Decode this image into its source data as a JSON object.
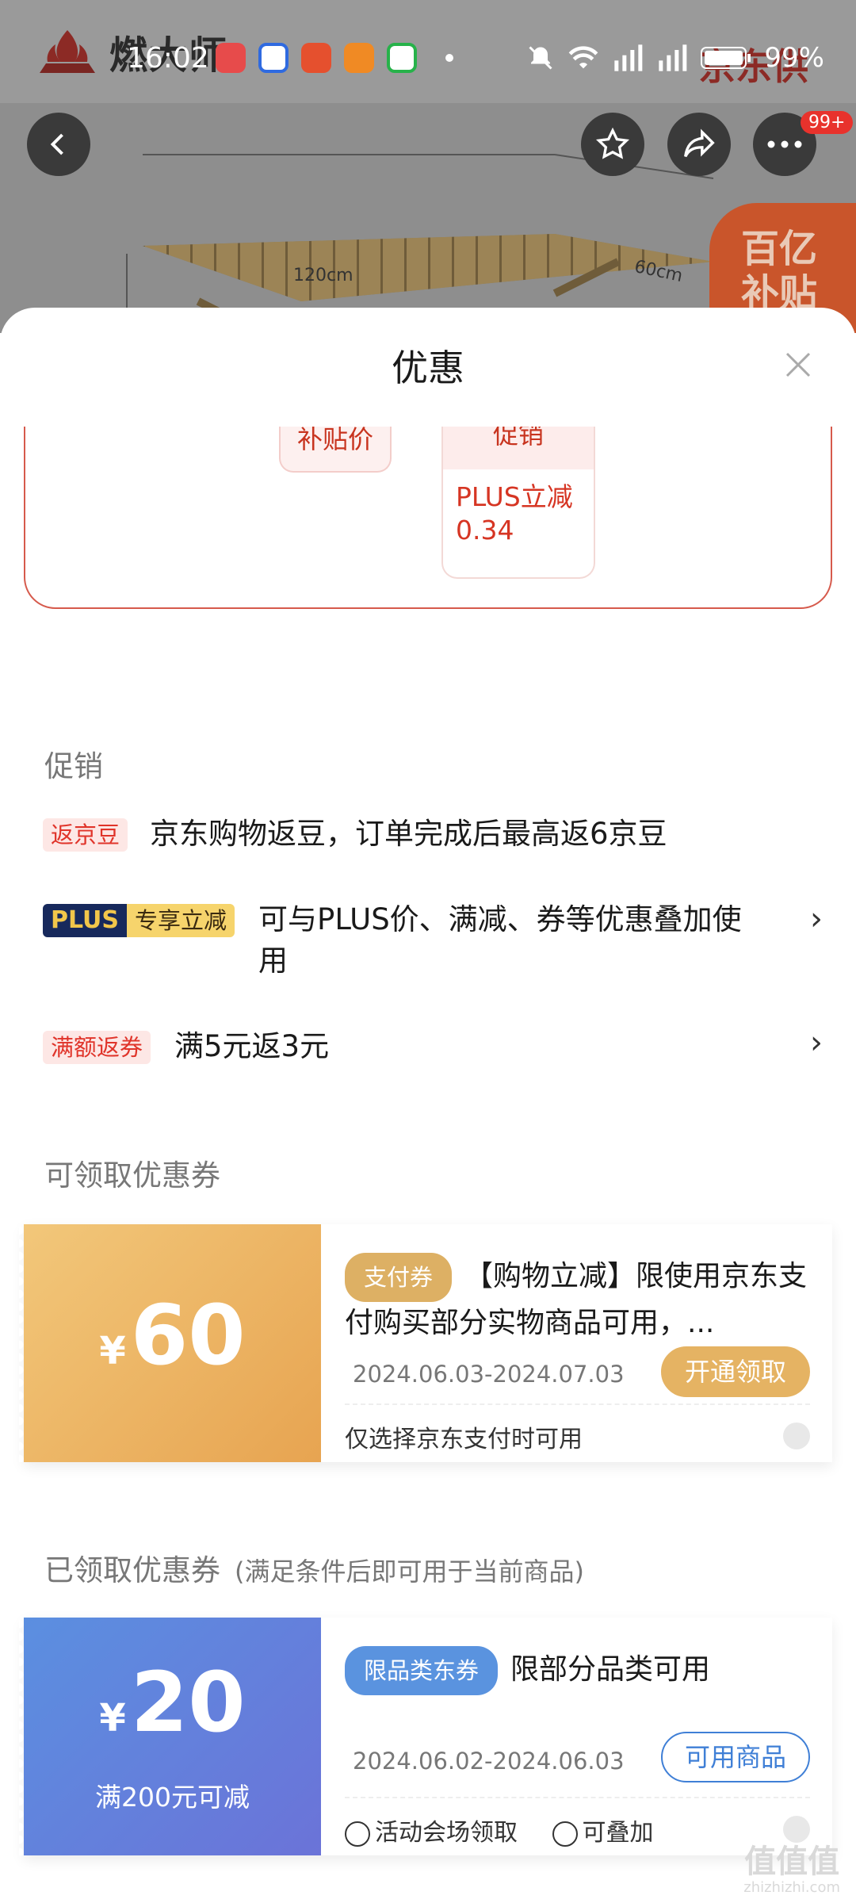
{
  "status_bar": {
    "time": "16:02",
    "battery": "99%",
    "icons": [
      "app-icon-1",
      "baidu-icon",
      "app-icon-3",
      "app-icon-4",
      "app-icon-5",
      "notification-dot",
      "mute-icon",
      "wifi-icon",
      "signal-5g-icon",
      "signal-5g-icon",
      "battery-icon"
    ]
  },
  "background": {
    "shop_brand": "燃大师",
    "shop_right_text": "京东供",
    "dimension_length": "120cm",
    "dimension_width": "60cm",
    "subsidy_badge_line1": "百亿",
    "subsidy_badge_line2": "补贴",
    "cart_badge": "99+"
  },
  "sheet": {
    "title": "优惠",
    "price_card": {
      "subsidy_pill": "补贴价",
      "promo_header": "促销",
      "promo_value": "PLUS立减0.34"
    },
    "promotions": {
      "section_title": "促销",
      "items": [
        {
          "tag": "返京豆",
          "text": "京东购物返豆，订单完成后最高返6京豆"
        },
        {
          "tag_a": "PLUS",
          "tag_b": "专享立减",
          "text": "可与PLUS价、满减、券等优惠叠加使用"
        },
        {
          "tag": "满额返券",
          "text": "满5元返3元"
        }
      ]
    },
    "claimable": {
      "section_title": "可领取优惠券",
      "coupon": {
        "currency": "¥",
        "amount": "60",
        "tag": "支付券",
        "title": "【购物立减】限使用京东支付购买部分实物商品可用，...",
        "date": "2024.06.03-2024.07.03",
        "button": "开通领取",
        "footer": "仅选择京东支付时可用"
      }
    },
    "claimed": {
      "section_title": "已领取优惠券",
      "note": "(满足条件后即可用于当前商品)",
      "coupon": {
        "currency": "¥",
        "amount": "20",
        "condition": "满200元可减",
        "tag": "限品类东券",
        "title": "限部分品类可用",
        "date": "2024.06.02-2024.06.03",
        "button": "可用商品",
        "footer_a": "活动会场领取",
        "footer_b": "可叠加"
      }
    },
    "watermark": "值值值",
    "watermark_sub": "zhizhizhi.com"
  },
  "colors": {
    "accent_red": "#e0342a",
    "gold_start": "#f2c77a",
    "gold_end": "#e7a451",
    "blue_start": "#5b8fe0",
    "blue_end": "#6b73d8"
  }
}
